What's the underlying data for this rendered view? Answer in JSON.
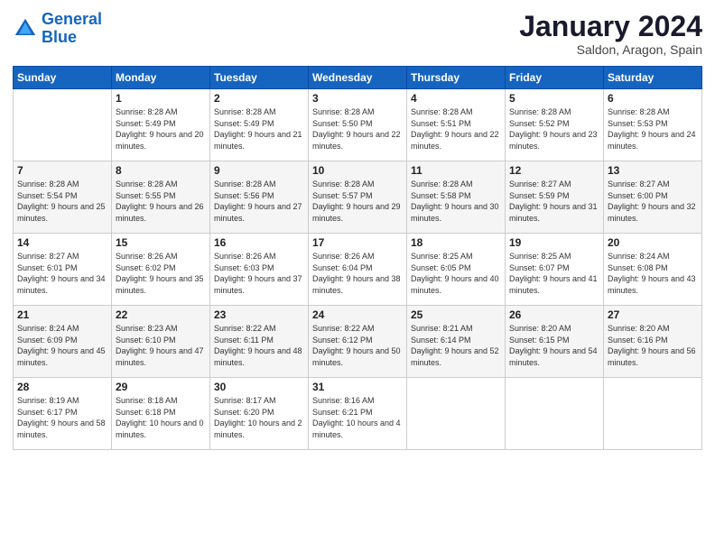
{
  "logo": {
    "line1": "General",
    "line2": "Blue"
  },
  "title": "January 2024",
  "subtitle": "Saldon, Aragon, Spain",
  "weekdays": [
    "Sunday",
    "Monday",
    "Tuesday",
    "Wednesday",
    "Thursday",
    "Friday",
    "Saturday"
  ],
  "weeks": [
    [
      {
        "num": "",
        "sunrise": "",
        "sunset": "",
        "daylight": ""
      },
      {
        "num": "1",
        "sunrise": "Sunrise: 8:28 AM",
        "sunset": "Sunset: 5:49 PM",
        "daylight": "Daylight: 9 hours and 20 minutes."
      },
      {
        "num": "2",
        "sunrise": "Sunrise: 8:28 AM",
        "sunset": "Sunset: 5:49 PM",
        "daylight": "Daylight: 9 hours and 21 minutes."
      },
      {
        "num": "3",
        "sunrise": "Sunrise: 8:28 AM",
        "sunset": "Sunset: 5:50 PM",
        "daylight": "Daylight: 9 hours and 22 minutes."
      },
      {
        "num": "4",
        "sunrise": "Sunrise: 8:28 AM",
        "sunset": "Sunset: 5:51 PM",
        "daylight": "Daylight: 9 hours and 22 minutes."
      },
      {
        "num": "5",
        "sunrise": "Sunrise: 8:28 AM",
        "sunset": "Sunset: 5:52 PM",
        "daylight": "Daylight: 9 hours and 23 minutes."
      },
      {
        "num": "6",
        "sunrise": "Sunrise: 8:28 AM",
        "sunset": "Sunset: 5:53 PM",
        "daylight": "Daylight: 9 hours and 24 minutes."
      }
    ],
    [
      {
        "num": "7",
        "sunrise": "Sunrise: 8:28 AM",
        "sunset": "Sunset: 5:54 PM",
        "daylight": "Daylight: 9 hours and 25 minutes."
      },
      {
        "num": "8",
        "sunrise": "Sunrise: 8:28 AM",
        "sunset": "Sunset: 5:55 PM",
        "daylight": "Daylight: 9 hours and 26 minutes."
      },
      {
        "num": "9",
        "sunrise": "Sunrise: 8:28 AM",
        "sunset": "Sunset: 5:56 PM",
        "daylight": "Daylight: 9 hours and 27 minutes."
      },
      {
        "num": "10",
        "sunrise": "Sunrise: 8:28 AM",
        "sunset": "Sunset: 5:57 PM",
        "daylight": "Daylight: 9 hours and 29 minutes."
      },
      {
        "num": "11",
        "sunrise": "Sunrise: 8:28 AM",
        "sunset": "Sunset: 5:58 PM",
        "daylight": "Daylight: 9 hours and 30 minutes."
      },
      {
        "num": "12",
        "sunrise": "Sunrise: 8:27 AM",
        "sunset": "Sunset: 5:59 PM",
        "daylight": "Daylight: 9 hours and 31 minutes."
      },
      {
        "num": "13",
        "sunrise": "Sunrise: 8:27 AM",
        "sunset": "Sunset: 6:00 PM",
        "daylight": "Daylight: 9 hours and 32 minutes."
      }
    ],
    [
      {
        "num": "14",
        "sunrise": "Sunrise: 8:27 AM",
        "sunset": "Sunset: 6:01 PM",
        "daylight": "Daylight: 9 hours and 34 minutes."
      },
      {
        "num": "15",
        "sunrise": "Sunrise: 8:26 AM",
        "sunset": "Sunset: 6:02 PM",
        "daylight": "Daylight: 9 hours and 35 minutes."
      },
      {
        "num": "16",
        "sunrise": "Sunrise: 8:26 AM",
        "sunset": "Sunset: 6:03 PM",
        "daylight": "Daylight: 9 hours and 37 minutes."
      },
      {
        "num": "17",
        "sunrise": "Sunrise: 8:26 AM",
        "sunset": "Sunset: 6:04 PM",
        "daylight": "Daylight: 9 hours and 38 minutes."
      },
      {
        "num": "18",
        "sunrise": "Sunrise: 8:25 AM",
        "sunset": "Sunset: 6:05 PM",
        "daylight": "Daylight: 9 hours and 40 minutes."
      },
      {
        "num": "19",
        "sunrise": "Sunrise: 8:25 AM",
        "sunset": "Sunset: 6:07 PM",
        "daylight": "Daylight: 9 hours and 41 minutes."
      },
      {
        "num": "20",
        "sunrise": "Sunrise: 8:24 AM",
        "sunset": "Sunset: 6:08 PM",
        "daylight": "Daylight: 9 hours and 43 minutes."
      }
    ],
    [
      {
        "num": "21",
        "sunrise": "Sunrise: 8:24 AM",
        "sunset": "Sunset: 6:09 PM",
        "daylight": "Daylight: 9 hours and 45 minutes."
      },
      {
        "num": "22",
        "sunrise": "Sunrise: 8:23 AM",
        "sunset": "Sunset: 6:10 PM",
        "daylight": "Daylight: 9 hours and 47 minutes."
      },
      {
        "num": "23",
        "sunrise": "Sunrise: 8:22 AM",
        "sunset": "Sunset: 6:11 PM",
        "daylight": "Daylight: 9 hours and 48 minutes."
      },
      {
        "num": "24",
        "sunrise": "Sunrise: 8:22 AM",
        "sunset": "Sunset: 6:12 PM",
        "daylight": "Daylight: 9 hours and 50 minutes."
      },
      {
        "num": "25",
        "sunrise": "Sunrise: 8:21 AM",
        "sunset": "Sunset: 6:14 PM",
        "daylight": "Daylight: 9 hours and 52 minutes."
      },
      {
        "num": "26",
        "sunrise": "Sunrise: 8:20 AM",
        "sunset": "Sunset: 6:15 PM",
        "daylight": "Daylight: 9 hours and 54 minutes."
      },
      {
        "num": "27",
        "sunrise": "Sunrise: 8:20 AM",
        "sunset": "Sunset: 6:16 PM",
        "daylight": "Daylight: 9 hours and 56 minutes."
      }
    ],
    [
      {
        "num": "28",
        "sunrise": "Sunrise: 8:19 AM",
        "sunset": "Sunset: 6:17 PM",
        "daylight": "Daylight: 9 hours and 58 minutes."
      },
      {
        "num": "29",
        "sunrise": "Sunrise: 8:18 AM",
        "sunset": "Sunset: 6:18 PM",
        "daylight": "Daylight: 10 hours and 0 minutes."
      },
      {
        "num": "30",
        "sunrise": "Sunrise: 8:17 AM",
        "sunset": "Sunset: 6:20 PM",
        "daylight": "Daylight: 10 hours and 2 minutes."
      },
      {
        "num": "31",
        "sunrise": "Sunrise: 8:16 AM",
        "sunset": "Sunset: 6:21 PM",
        "daylight": "Daylight: 10 hours and 4 minutes."
      },
      {
        "num": "",
        "sunrise": "",
        "sunset": "",
        "daylight": ""
      },
      {
        "num": "",
        "sunrise": "",
        "sunset": "",
        "daylight": ""
      },
      {
        "num": "",
        "sunrise": "",
        "sunset": "",
        "daylight": ""
      }
    ]
  ]
}
